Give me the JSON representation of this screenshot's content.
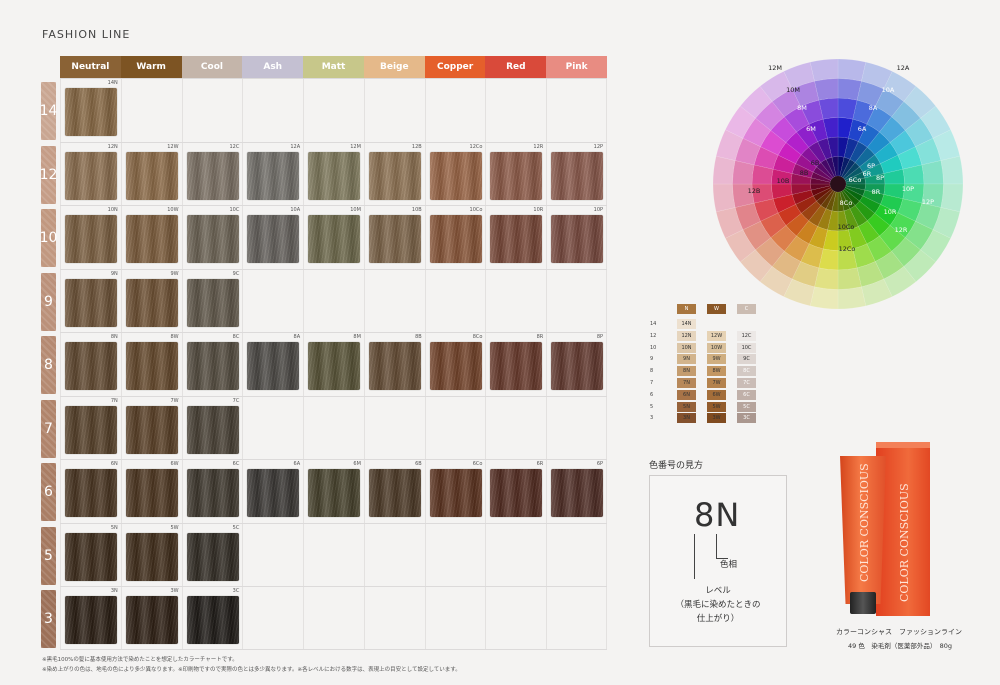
{
  "page": {
    "title": "FASHION LINE"
  },
  "columns": [
    {
      "label": "Neutral",
      "color": "#8a6235"
    },
    {
      "label": "Warm",
      "color": "#7d5423"
    },
    {
      "label": "Cool",
      "color": "#c4b5aa"
    },
    {
      "label": "Ash",
      "color": "#c4c0d2"
    },
    {
      "label": "Matt",
      "color": "#c7c78a"
    },
    {
      "label": "Beige",
      "color": "#e5b98a"
    },
    {
      "label": "Copper",
      "color": "#e55f2b"
    },
    {
      "label": "Red",
      "color": "#d94a3a"
    },
    {
      "label": "Pink",
      "color": "#e88c82"
    }
  ],
  "rows": [
    {
      "level": "14",
      "tab_color": "#c9a692",
      "cells": [
        {
          "code": "14N",
          "color": "#8a6a45"
        },
        null,
        null,
        null,
        null,
        null,
        null,
        null,
        null
      ]
    },
    {
      "level": "12",
      "tab_color": "#c59d87",
      "cells": [
        {
          "code": "12N",
          "color": "#8e7050"
        },
        {
          "code": "12W",
          "color": "#8e6c48"
        },
        {
          "code": "12C",
          "color": "#7e7366"
        },
        {
          "code": "12A",
          "color": "#74716b"
        },
        {
          "code": "12M",
          "color": "#807a5c"
        },
        {
          "code": "12B",
          "color": "#8f7353"
        },
        {
          "code": "12Co",
          "color": "#9b6545"
        },
        {
          "code": "12R",
          "color": "#8f5b48"
        },
        {
          "code": "12P",
          "color": "#8c5a4c"
        }
      ]
    },
    {
      "level": "10",
      "tab_color": "#c19880",
      "cells": [
        {
          "code": "10N",
          "color": "#7d6142"
        },
        {
          "code": "10W",
          "color": "#7e5e3d"
        },
        {
          "code": "10C",
          "color": "#6e6556"
        },
        {
          "code": "10A",
          "color": "#66625d"
        },
        {
          "code": "10M",
          "color": "#6f6a4c"
        },
        {
          "code": "10B",
          "color": "#7d6448"
        },
        {
          "code": "10Co",
          "color": "#8a5638"
        },
        {
          "code": "10R",
          "color": "#7a4838"
        },
        {
          "code": "10P",
          "color": "#7a4a3f"
        }
      ]
    },
    {
      "level": "9",
      "tab_color": "#bb917a",
      "cells": [
        {
          "code": "9N",
          "color": "#6f5438"
        },
        {
          "code": "9W",
          "color": "#705234"
        },
        {
          "code": "9C",
          "color": "#62594b"
        },
        null,
        null,
        null,
        null,
        null,
        null
      ]
    },
    {
      "level": "8",
      "tab_color": "#b58a72",
      "cells": [
        {
          "code": "8N",
          "color": "#634a31"
        },
        {
          "code": "8W",
          "color": "#674a2d"
        },
        {
          "code": "8C",
          "color": "#564e41"
        },
        {
          "code": "8A",
          "color": "#4d4a46"
        },
        {
          "code": "8M",
          "color": "#5a5538"
        },
        {
          "code": "8B",
          "color": "#664d35"
        },
        {
          "code": "8Co",
          "color": "#75442a"
        },
        {
          "code": "8R",
          "color": "#6a3a2c"
        },
        {
          "code": "8P",
          "color": "#653a30"
        }
      ]
    },
    {
      "level": "7",
      "tab_color": "#b0846b",
      "cells": [
        {
          "code": "7N",
          "color": "#574129"
        },
        {
          "code": "7W",
          "color": "#5b4127"
        },
        {
          "code": "7C",
          "color": "#4a4236"
        },
        null,
        null,
        null,
        null,
        null,
        null
      ]
    },
    {
      "level": "6",
      "tab_color": "#aa7e65",
      "cells": [
        {
          "code": "6N",
          "color": "#4b3622"
        },
        {
          "code": "6W",
          "color": "#4f3721"
        },
        {
          "code": "6C",
          "color": "#3f382e"
        },
        {
          "code": "6A",
          "color": "#3b3835"
        },
        {
          "code": "6M",
          "color": "#48432d"
        },
        {
          "code": "6B",
          "color": "#4e3a27"
        },
        {
          "code": "6Co",
          "color": "#5e3420"
        },
        {
          "code": "6R",
          "color": "#552d22"
        },
        {
          "code": "6P",
          "color": "#512e26"
        }
      ]
    },
    {
      "level": "5",
      "tab_color": "#a4785f",
      "cells": [
        {
          "code": "5N",
          "color": "#3f2d1c"
        },
        {
          "code": "5W",
          "color": "#422e1b"
        },
        {
          "code": "5C",
          "color": "#332d25"
        },
        null,
        null,
        null,
        null,
        null,
        null
      ]
    },
    {
      "level": "3",
      "tab_color": "#9c7058",
      "cells": [
        {
          "code": "3N",
          "color": "#2c1f14"
        },
        {
          "code": "3W",
          "color": "#2f2014"
        },
        {
          "code": "3C",
          "color": "#1f1b17"
        },
        null,
        null,
        null,
        null,
        null,
        null
      ]
    }
  ],
  "footnotes": [
    "※黒毛100%の髪に基本使用方法で染めたことを想定したカラーチャートです。",
    "※染め上がりの色は、地毛の色により多少異なります。※印刷物ですので実際の色とは多少異なります。※各レベルにおける数字は、表現上の目安として設定しています。"
  ],
  "wheel": {
    "labels": [
      "12M",
      "12A",
      "10M",
      "10A",
      "8M",
      "8A",
      "6M",
      "6A",
      "6B",
      "6P",
      "8B",
      "6Co",
      "6R",
      "10B",
      "8P",
      "8R",
      "10P",
      "12B",
      "8Co",
      "12P",
      "10R",
      "10Co",
      "12R",
      "12Co"
    ]
  },
  "mini_chart": {
    "headers": [
      {
        "label": "N",
        "color": "#a8763f"
      },
      {
        "label": "W",
        "color": "#8a5726"
      },
      {
        "label": "C",
        "color": "#cbbcb2"
      }
    ],
    "levels": [
      "14",
      "12",
      "10",
      "9",
      "8",
      "7",
      "6",
      "5",
      "3"
    ],
    "rows": [
      [
        "14N",
        "",
        ""
      ],
      [
        "12N",
        "12W",
        "12C"
      ],
      [
        "10N",
        "10W",
        "10C"
      ],
      [
        "9N",
        "9W",
        "9C"
      ],
      [
        "8N",
        "8W",
        "8C"
      ],
      [
        "7N",
        "7W",
        "7C"
      ],
      [
        "6N",
        "6W",
        "6C"
      ],
      [
        "5N",
        "5W",
        "5C"
      ],
      [
        "3N",
        "3W",
        "3C"
      ]
    ],
    "colors": [
      [
        "#ede0cf",
        "",
        ""
      ],
      [
        "#e6d5be",
        "#e6d2b4",
        "#ece8e6"
      ],
      [
        "#dcc6a8",
        "#d9c09b",
        "#e6e0dd"
      ],
      [
        "#d2b48c",
        "#cfae80",
        "#ddd5d1"
      ],
      [
        "#c49c6e",
        "#c39763",
        "#d3c9c4"
      ],
      [
        "#b7885a",
        "#b4824d",
        "#cabcb6"
      ],
      [
        "#a87448",
        "#a46e3a",
        "#c0b0a9"
      ],
      [
        "#96623a",
        "#935c2c",
        "#b6a49c"
      ],
      [
        "#84512d",
        "#804b20",
        "#aa978f"
      ]
    ]
  },
  "legend": {
    "title": "色番号の見方",
    "code": "8N",
    "hue_label": "色相",
    "level_lines": [
      "レベル",
      "（黒毛に染めたときの",
      "仕上がり）"
    ]
  },
  "product": {
    "brand": "COLOR CONSCIOUS",
    "name": "カラーコンシャス　ファッションライン",
    "desc": "49 色　染毛剤（医薬部外品）　80g"
  }
}
